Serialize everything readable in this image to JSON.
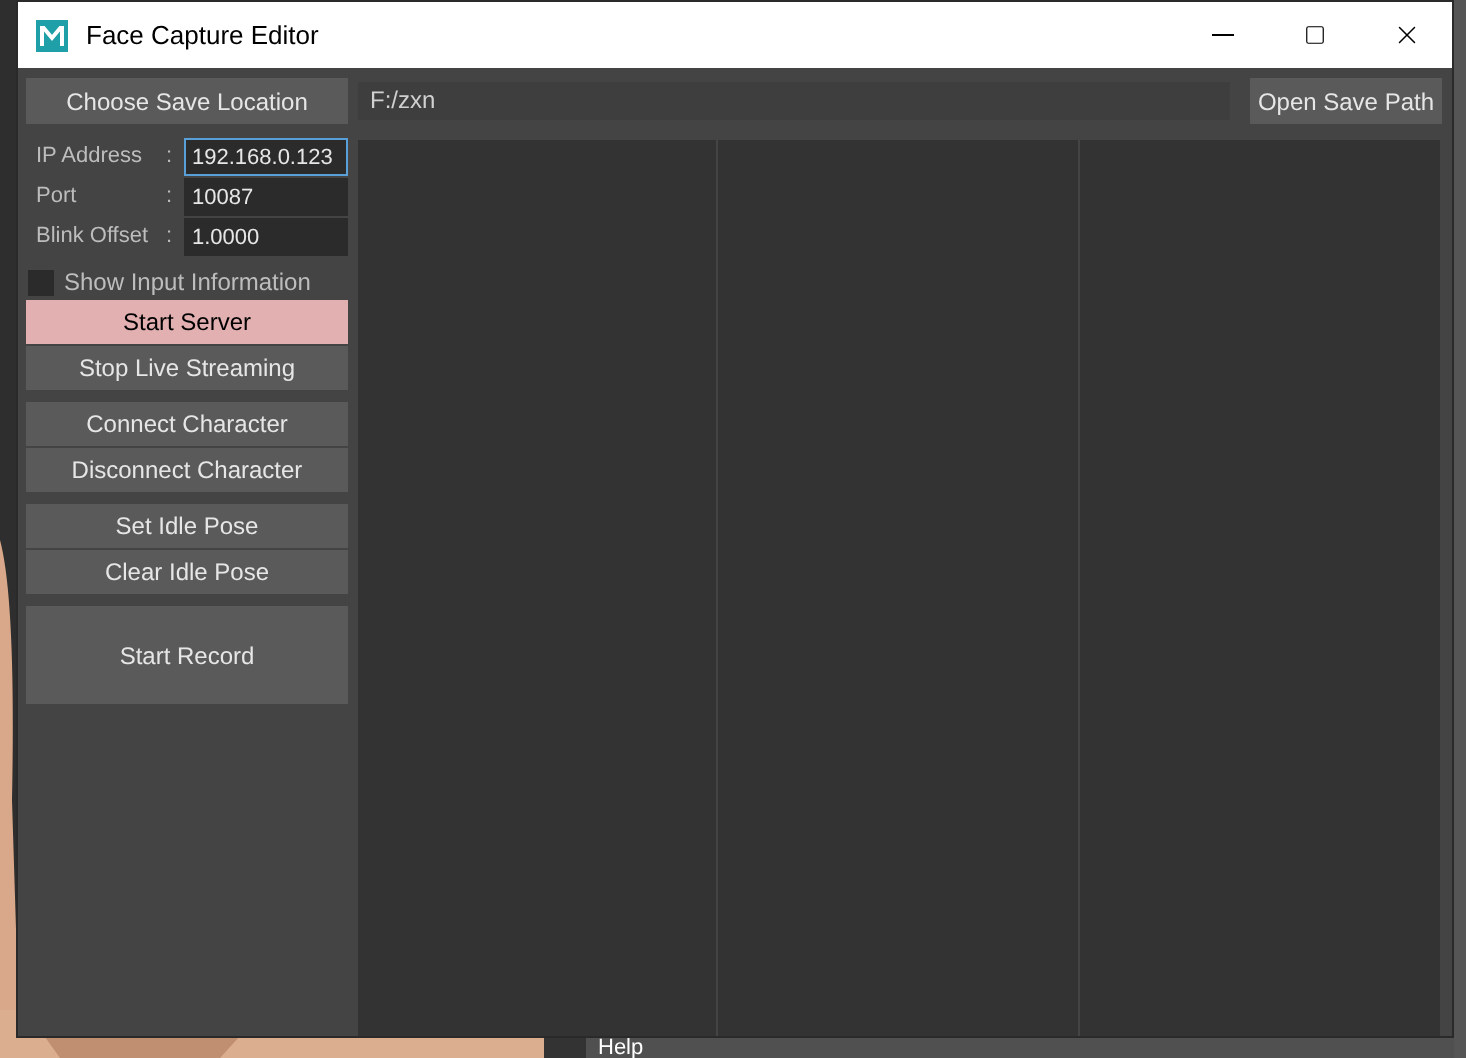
{
  "window": {
    "title": "Face Capture Editor"
  },
  "save_location": {
    "button": "Choose Save Location",
    "path": "F:/zxn",
    "open_button": "Open Save Path"
  },
  "fields": [
    {
      "label": "IP Address",
      "separator": ":",
      "value": "192.168.0.123",
      "focused": true
    },
    {
      "label": "Port",
      "separator": ":",
      "value": "10087",
      "focused": false
    },
    {
      "label": "Blink Offset",
      "separator": ":",
      "value": "1.0000",
      "focused": false
    }
  ],
  "show_input_information": {
    "label": "Show Input Information",
    "checked": false
  },
  "button_groups": [
    {
      "kind": "pair",
      "buttons": [
        {
          "label": "Start Server",
          "active": true
        },
        {
          "label": "Stop Live Streaming",
          "active": false
        }
      ]
    },
    {
      "kind": "pair",
      "buttons": [
        {
          "label": "Connect Character",
          "active": false
        },
        {
          "label": "Disconnect Character",
          "active": false
        }
      ]
    },
    {
      "kind": "pair",
      "buttons": [
        {
          "label": "Set Idle Pose",
          "active": false
        },
        {
          "label": "Clear Idle Pose",
          "active": false
        }
      ]
    },
    {
      "kind": "large",
      "buttons": [
        {
          "label": "Start Record",
          "active": false
        }
      ]
    }
  ],
  "background_menu": {
    "item": "Help"
  }
}
